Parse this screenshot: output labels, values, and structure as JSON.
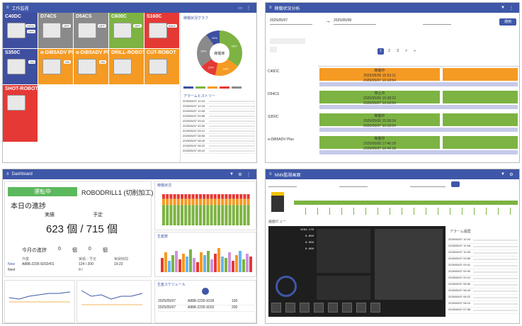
{
  "tl": {
    "title": "工作监视",
    "tiles": [
      {
        "name": "C40DC",
        "color": "#3f4fa0",
        "tags": [
          "100%",
          "OFF"
        ]
      },
      {
        "name": "D74CS",
        "color": "#8a8a8a",
        "tags": [
          "OFF"
        ]
      },
      {
        "name": "D54CS",
        "color": "#8a8a8a",
        "tags": [
          "OFF"
        ]
      },
      {
        "name": "C600C",
        "color": "#7cb342",
        "tags": [
          "OFF"
        ]
      },
      {
        "name": "S160C",
        "color": "#e53935",
        "tags": [
          "SALE"
        ]
      },
      {
        "name": "S350C",
        "color": "#3f4fa0",
        "tags": [
          "ON"
        ]
      },
      {
        "name": "α-DiB5ADV Plus",
        "color": "#f59a23",
        "tags": [
          "ON"
        ]
      },
      {
        "name": "α-DiB5ADV Pl...",
        "color": "#f59a23",
        "tags": [
          "ON"
        ]
      },
      {
        "name": "DRILL-ROBOT",
        "color": "#f59a23",
        "tags": []
      },
      {
        "name": "CUT-ROBOT",
        "color": "#f59a23",
        "tags": []
      },
      {
        "name": "SHOT-ROBOT",
        "color": "#e53935",
        "tags": []
      }
    ],
    "donut_title": "稼働状況グラフ",
    "donut_center": "稼働率",
    "donut": [
      {
        "pct": 35,
        "color": "#7cb342"
      },
      {
        "pct": 18,
        "color": "#f59a23"
      },
      {
        "pct": 12,
        "color": "#e53935"
      },
      {
        "pct": 25,
        "color": "#8a8a8a"
      },
      {
        "pct": 10,
        "color": "#3f4fa0"
      }
    ],
    "donut_labels": [
      "35%",
      "18%",
      "12%",
      "25%",
      "10%"
    ],
    "list_title": "アラームヒストリー",
    "list_rows": [
      "2025/05/07 10:23",
      "2025/05/07 10:18",
      "2025/05/07 10:05",
      "2025/05/07 09:58",
      "2025/05/07 09:41",
      "2025/05/07 09:30",
      "2025/05/07 09:12",
      "2025/05/07 08:55",
      "2025/05/07 08:40",
      "2025/05/07 08:22",
      "2025/05/07 08:10"
    ]
  },
  "tr": {
    "title": "稼働状況分析",
    "date_from": "2025/05/07",
    "date_to": "2025/05/08",
    "apply": "適用",
    "pages": [
      "1",
      "2",
      "3",
      ">",
      "»"
    ],
    "machines": [
      "C40DC",
      "D54CS",
      "S350C",
      "α-DiB5ADV Plus"
    ],
    "bars": [
      {
        "label": "稼働中",
        "time1": "2025/05/06 15:53:11",
        "time2": "2025/05/07 10:18:54"
      },
      {
        "label": "停止中",
        "time1": "2025/05/06 15:38:22",
        "time2": "2025/05/07 10:18:54"
      },
      {
        "label": "稼働中",
        "time1": "2025/05/06 15:38:24",
        "time2": "2025/05/07 10:18:54"
      },
      {
        "label": "稼働中",
        "time1": "2025/05/06 17:46:18",
        "time2": "2025/05/07 16:46:18"
      }
    ]
  },
  "bl": {
    "title": "Dashboard",
    "status": "運転中",
    "machine": "ROBODRILL1 (切削加工)",
    "today": "本日の進捗",
    "actual_label": "実績",
    "plan_label": "予定",
    "actual": "623",
    "plan": "715",
    "unit": "個",
    "month_label": "今月の進捗",
    "month_actual": "0",
    "month_plan": "0",
    "task_h": [
      "",
      "作業",
      "実績／予定",
      "実績時間"
    ],
    "task_now": [
      "Now",
      "A888-2235-9202#01",
      "124 / 200",
      "19:22"
    ],
    "task_next": [
      "Next",
      "",
      "0 /",
      ""
    ],
    "bar_title": "稼働状況",
    "line_title": "生産数",
    "schedule_title": "生産スケジュール",
    "sched_rows": [
      [
        "2025/05/07",
        "A888-2235-9109",
        "100"
      ],
      [
        "2025/05/07",
        "A888-2235-9202",
        "200"
      ]
    ]
  },
  "br": {
    "title": "NNN監視画面",
    "screen_title": "画面ビュー",
    "alarm_title": "アラーム履歴",
    "cnc_vals": [
      "1564.179",
      "0.000",
      "0.000",
      "0.000"
    ],
    "alarm_rows": [
      "2025/05/07 10:23",
      "2025/05/07 10:18",
      "2025/05/07 10:05",
      "2025/05/07 09:58",
      "2025/05/07 09:41",
      "2025/05/07 09:30",
      "2025/05/07 09:12",
      "2025/05/07 08:55",
      "2025/05/07 08:40",
      "2025/05/07 08:22",
      "2025/05/07 08:10",
      "2025/05/07 07:58"
    ]
  },
  "colors": {
    "accent": "#3f57a8",
    "green": "#7cb342",
    "orange": "#f59a23",
    "red": "#e53935",
    "gray": "#8a8a8a",
    "blue": "#3f4fa0"
  }
}
